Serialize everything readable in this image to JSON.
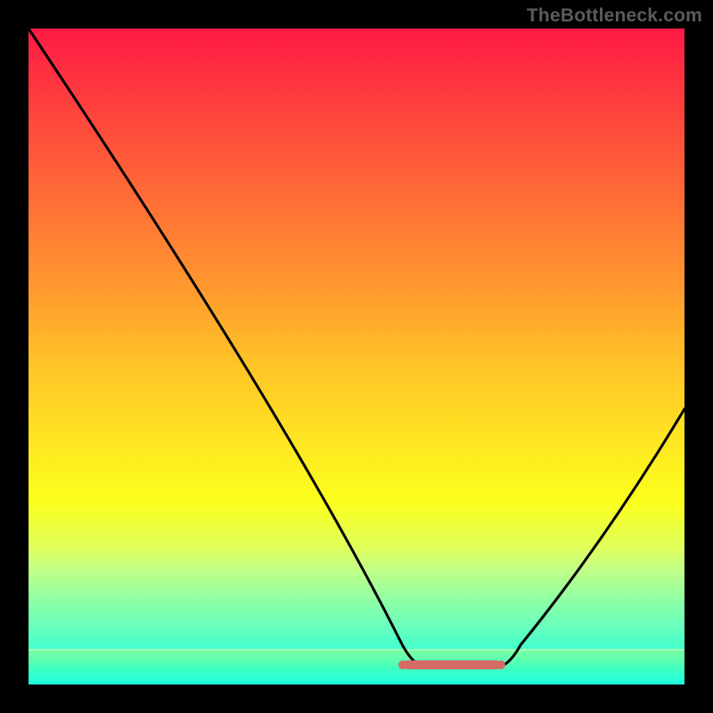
{
  "watermark": "TheBottleneck.com",
  "chart_data": {
    "type": "line",
    "title": "",
    "xlabel": "",
    "ylabel": "",
    "xlim": [
      0,
      100
    ],
    "ylim": [
      0,
      100
    ],
    "series": [
      {
        "name": "curve",
        "color": "#000000",
        "points": [
          {
            "x": 0,
            "y": 100
          },
          {
            "x": 57,
            "y": 6
          },
          {
            "x": 62,
            "y": 3
          },
          {
            "x": 70,
            "y": 3
          },
          {
            "x": 75,
            "y": 6
          },
          {
            "x": 100,
            "y": 42
          }
        ]
      }
    ],
    "markers": {
      "color": "#d66a65",
      "start_x": 57,
      "end_x": 72,
      "y": 3
    },
    "background_gradient": {
      "top": "#ff1a45",
      "mid": "#fff020",
      "bottom": "#15fff2"
    }
  }
}
